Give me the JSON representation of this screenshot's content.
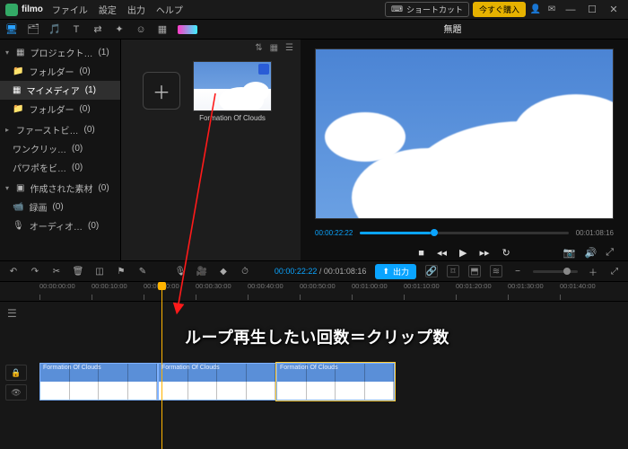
{
  "app": {
    "name": "filmo"
  },
  "menu": {
    "file": "ファイル",
    "settings": "設定",
    "output": "出力",
    "help": "ヘルプ"
  },
  "header": {
    "shortcut": "ショートカット",
    "buy_now": "今すぐ購入"
  },
  "project_title": "無題",
  "sidebar": {
    "project": {
      "label": "プロジェクト…",
      "count": "(1)"
    },
    "folder1": {
      "label": "フォルダー",
      "count": "(0)"
    },
    "mymedia": {
      "label": "マイメディア",
      "count": "(1)"
    },
    "folder2": {
      "label": "フォルダー",
      "count": "(0)"
    },
    "firstview": {
      "label": "ファーストビ…",
      "count": "(0)"
    },
    "oneclick": {
      "label": "ワンクリッ…",
      "count": "(0)"
    },
    "powapo": {
      "label": "パワポをビ…",
      "count": "(0)"
    },
    "created": {
      "label": "作成された素材",
      "count": "(0)"
    },
    "record": {
      "label": "録画",
      "count": "(0)"
    },
    "audio": {
      "label": "オーディオ…",
      "count": "(0)"
    }
  },
  "media": {
    "clip1_name": "Formation Of Clouds"
  },
  "preview": {
    "time_current": "00:00:22:22",
    "time_total": "00:01:08:16"
  },
  "timeline_toolbar": {
    "tc_current": "00:00:22:22",
    "tc_total": "00:01:08:16",
    "export": "出力"
  },
  "ruler": [
    "00:00:00:00",
    "00:00:10:00",
    "00:00:20:00",
    "00:00:30:00",
    "00:00:40:00",
    "00:00:50:00",
    "00:01:00:00",
    "00:01:10:00",
    "00:01:20:00",
    "00:01:30:00",
    "00:01:40:00"
  ],
  "clips": {
    "c1": "Formation Of Clouds",
    "c2": "Formation Of Clouds",
    "c3": "Formation Of Clouds"
  },
  "annotation": "ループ再生したい回数＝クリップ数"
}
